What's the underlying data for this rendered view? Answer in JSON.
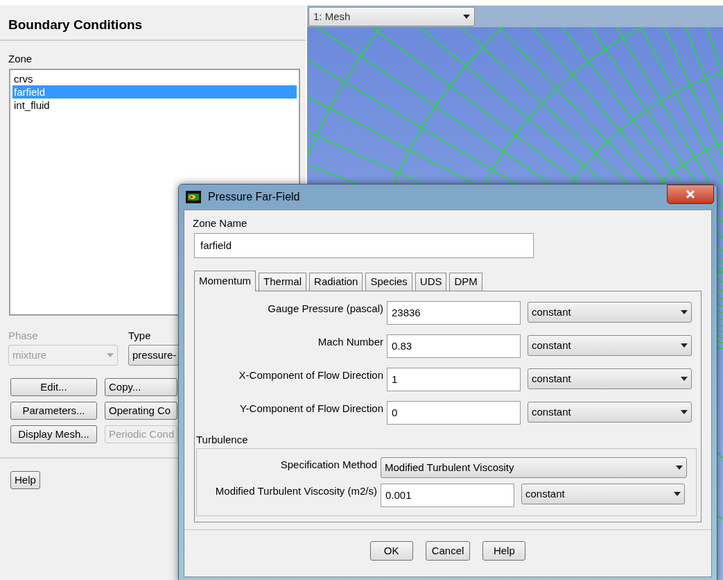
{
  "left_panel": {
    "title": "Boundary Conditions",
    "zone_label": "Zone",
    "zones": [
      {
        "label": "crvs",
        "selected": false
      },
      {
        "label": "farfield",
        "selected": true
      },
      {
        "label": "int_fluid",
        "selected": false
      }
    ],
    "phase": {
      "label": "Phase",
      "value": "mixture",
      "disabled": true
    },
    "type": {
      "label": "Type",
      "value": "pressure-"
    },
    "buttons": [
      {
        "label": "Edit...",
        "disabled": false
      },
      {
        "label": "Copy...",
        "disabled": false
      },
      {
        "label": "Parameters...",
        "disabled": false
      },
      {
        "label": "Operating Co",
        "disabled": false
      },
      {
        "label": "Display Mesh...",
        "disabled": false
      },
      {
        "label": "Periodic Cond",
        "disabled": true
      }
    ],
    "help_button": "Help"
  },
  "graphics": {
    "view_dropdown": "1: Mesh"
  },
  "dialog": {
    "title": "Pressure Far-Field",
    "zone_name_label": "Zone Name",
    "zone_name": "farfield",
    "tabs": [
      {
        "label": "Momentum",
        "selected": true
      },
      {
        "label": "Thermal",
        "selected": false
      },
      {
        "label": "Radiation",
        "selected": false
      },
      {
        "label": "Species",
        "selected": false
      },
      {
        "label": "UDS",
        "selected": false
      },
      {
        "label": "DPM",
        "selected": false
      }
    ],
    "momentum_fields": [
      {
        "label": "Gauge Pressure (pascal)",
        "value": "23836",
        "method": "constant"
      },
      {
        "label": "Mach Number",
        "value": "0.83",
        "method": "constant"
      },
      {
        "label": "X-Component of Flow Direction",
        "value": "1",
        "method": "constant"
      },
      {
        "label": "Y-Component of Flow Direction",
        "value": "0",
        "method": "constant"
      }
    ],
    "turbulence": {
      "title": "Turbulence",
      "spec_label": "Specification Method",
      "spec_value": "Modified Turbulent Viscosity",
      "fields": [
        {
          "label": "Modified Turbulent Viscosity (m2/s)",
          "value": "0.001",
          "method": "constant"
        }
      ]
    },
    "buttons": [
      "OK",
      "Cancel",
      "Help"
    ]
  }
}
